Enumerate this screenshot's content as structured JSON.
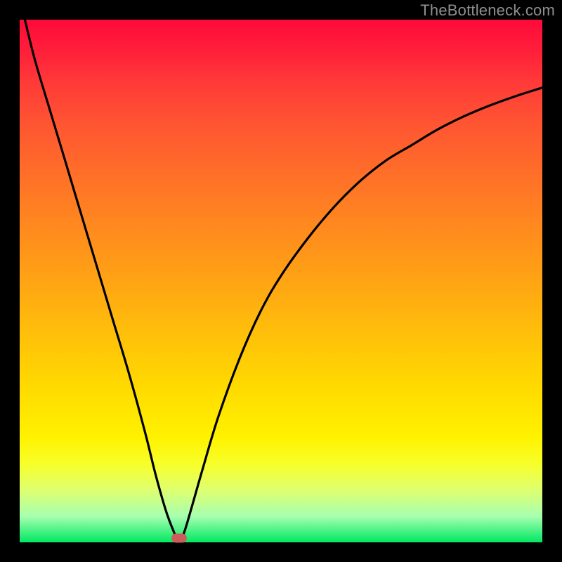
{
  "watermark": "TheBottleneck.com",
  "marker": {
    "x_pct": 30.5,
    "y_pct": 99.2
  },
  "chart_data": {
    "type": "line",
    "title": "",
    "xlabel": "",
    "ylabel": "",
    "xlim": [
      0,
      100
    ],
    "ylim": [
      0,
      100
    ],
    "series": [
      {
        "name": "bottleneck-curve",
        "x": [
          1,
          3,
          6,
          9,
          12,
          15,
          18,
          21,
          24,
          26,
          28,
          29.5,
          30.5,
          31.5,
          33,
          35,
          38,
          42,
          46,
          50,
          55,
          60,
          65,
          70,
          75,
          80,
          85,
          90,
          95,
          100
        ],
        "values": [
          100,
          92,
          82,
          72,
          62,
          52,
          42,
          32,
          21,
          13,
          6,
          2,
          0,
          2,
          7,
          14,
          24,
          35,
          44,
          51,
          58,
          64,
          69,
          73,
          76,
          79,
          81.5,
          83.6,
          85.4,
          87
        ]
      }
    ],
    "annotations": [
      {
        "type": "marker",
        "x": 30.5,
        "y": 0.8,
        "color": "#cc5c5c"
      }
    ],
    "background_gradient": {
      "top": "#ff0a3a",
      "mid": "#ffd900",
      "bottom": "#00e862"
    }
  }
}
